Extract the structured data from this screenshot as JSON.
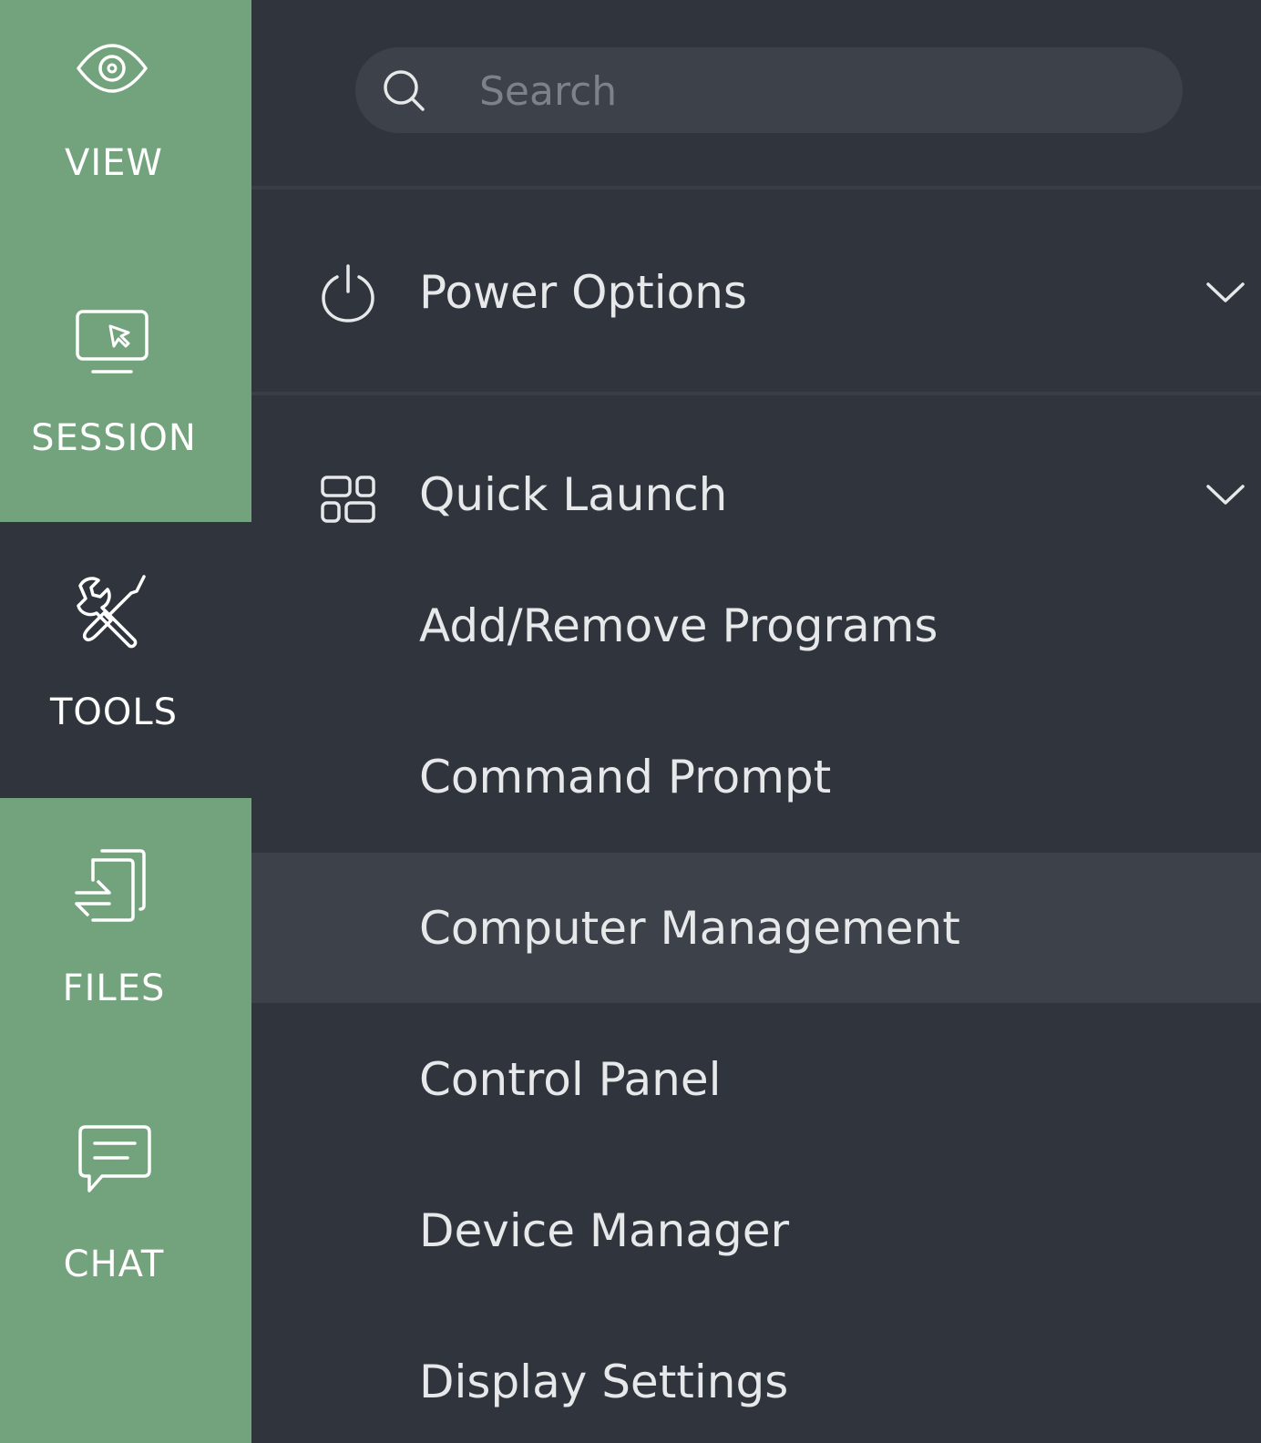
{
  "rail": {
    "items": [
      {
        "label": "VIEW",
        "icon": "eye-icon",
        "active": false
      },
      {
        "label": "SESSION",
        "icon": "monitor-cursor-icon",
        "active": false
      },
      {
        "label": "TOOLS",
        "icon": "tools-icon",
        "active": true
      },
      {
        "label": "FILES",
        "icon": "file-transfer-icon",
        "active": false
      },
      {
        "label": "CHAT",
        "icon": "chat-icon",
        "active": false
      }
    ]
  },
  "search": {
    "placeholder": "Search",
    "value": ""
  },
  "sections": {
    "power": {
      "label": "Power Options",
      "icon": "power-icon",
      "expanded": false
    },
    "quick_launch": {
      "label": "Quick Launch",
      "icon": "grid-icon",
      "expanded": true,
      "items": [
        {
          "label": "Add/Remove Programs"
        },
        {
          "label": "Command Prompt"
        },
        {
          "label": "Computer Management",
          "highlighted": true
        },
        {
          "label": "Control Panel"
        },
        {
          "label": "Device Manager"
        },
        {
          "label": "Display Settings"
        }
      ]
    }
  },
  "colors": {
    "rail_green": "#73a37c",
    "panel_bg": "#30343d",
    "highlight_bg": "#3d4149",
    "text": "#e6e8ea",
    "placeholder": "#7d828a"
  }
}
